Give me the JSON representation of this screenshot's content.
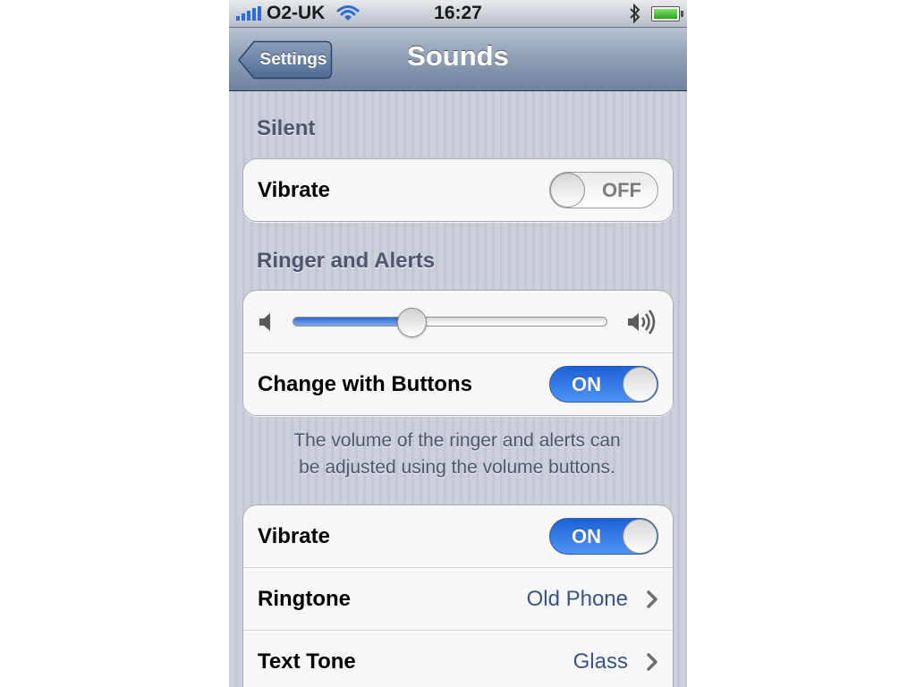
{
  "status_bar": {
    "carrier": "O2-UK",
    "time": "16:27",
    "signal_bars": 5,
    "battery_level": 1.0
  },
  "nav": {
    "back_label": "Settings",
    "title": "Sounds"
  },
  "silent": {
    "header": "Silent",
    "vibrate_label": "Vibrate",
    "vibrate_state": "OFF"
  },
  "ringer": {
    "header": "Ringer and Alerts",
    "volume_level": 0.38,
    "change_with_buttons_label": "Change with Buttons",
    "change_with_buttons_state": "ON",
    "footnote_line1": "The volume of the ringer and alerts can",
    "footnote_line2": "be adjusted using the volume buttons."
  },
  "tones": {
    "vibrate_label": "Vibrate",
    "vibrate_state": "ON",
    "ringtone_label": "Ringtone",
    "ringtone_value": "Old Phone",
    "text_tone_label": "Text Tone",
    "text_tone_value": "Glass"
  },
  "icons": {
    "signal": "signal-bars-icon",
    "wifi": "wifi-icon",
    "bluetooth": "bluetooth-icon",
    "battery": "battery-icon",
    "volume_low": "speaker-low-icon",
    "volume_high": "speaker-high-icon",
    "chevron": "chevron-right-icon"
  },
  "colors": {
    "switch_on": "#2f78e6",
    "value_text": "#385487",
    "nav_bar": "#8d9db4",
    "background": "#c7ccd6"
  }
}
